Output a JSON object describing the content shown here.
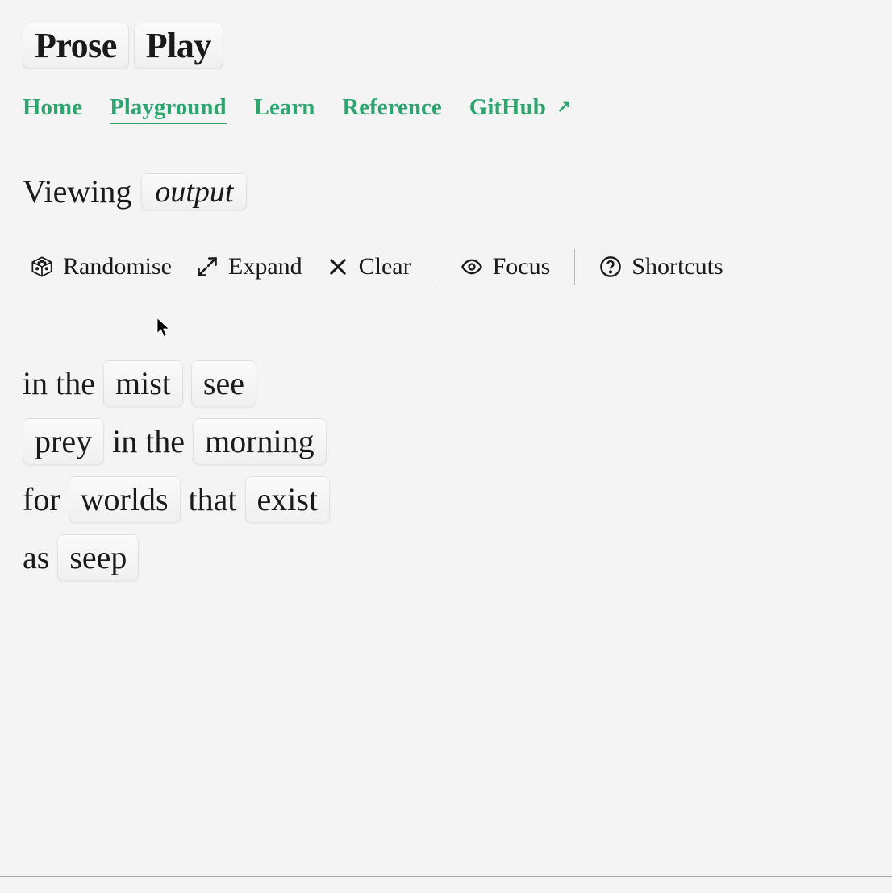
{
  "title": {
    "word1": "Prose",
    "word2": "Play"
  },
  "nav": {
    "home": "Home",
    "playground": "Playground",
    "learn": "Learn",
    "reference": "Reference",
    "github": "GitHub"
  },
  "viewing": {
    "label": "Viewing",
    "chip": "output"
  },
  "toolbar": {
    "randomise": "Randomise",
    "expand": "Expand",
    "clear": "Clear",
    "focus": "Focus",
    "shortcuts": "Shortcuts"
  },
  "content": {
    "lines": [
      {
        "segments": [
          {
            "kind": "plain",
            "text": "in the"
          },
          {
            "kind": "chip",
            "text": "mist"
          },
          {
            "kind": "chip",
            "text": "see"
          }
        ]
      },
      {
        "segments": [
          {
            "kind": "chip",
            "text": "prey"
          },
          {
            "kind": "plain",
            "text": "in the"
          },
          {
            "kind": "chip",
            "text": "morning"
          }
        ]
      },
      {
        "segments": [
          {
            "kind": "plain",
            "text": "for"
          },
          {
            "kind": "chip",
            "text": "worlds"
          },
          {
            "kind": "plain",
            "text": "that"
          },
          {
            "kind": "chip",
            "text": "exist"
          }
        ]
      },
      {
        "segments": [
          {
            "kind": "plain",
            "text": "as"
          },
          {
            "kind": "chip",
            "text": "seep"
          }
        ]
      }
    ]
  }
}
